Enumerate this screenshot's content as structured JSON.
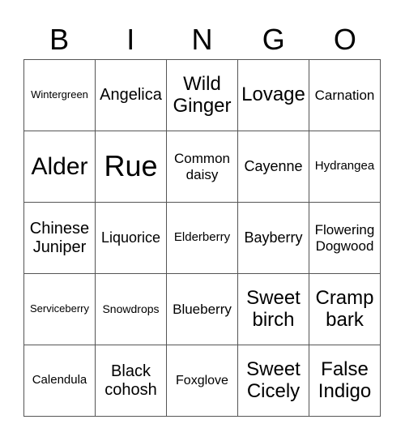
{
  "header": [
    "B",
    "I",
    "N",
    "G",
    "O"
  ],
  "cells": [
    [
      "Wintergreen",
      "Angelica",
      "Wild Ginger",
      "Lovage",
      "Carnation"
    ],
    [
      "Alder",
      "Rue",
      "Common daisy",
      "Cayenne",
      "Hydrangea"
    ],
    [
      "Chinese Juniper",
      "Liquorice",
      "Elderberry",
      "Bayberry",
      "Flowering Dogwood"
    ],
    [
      "Serviceberry",
      "Snowdrops",
      "Blueberry",
      "Sweet birch",
      "Cramp bark"
    ],
    [
      "Calendula",
      "Black cohosh",
      "Foxglove",
      "Sweet Cicely",
      "False Indigo"
    ]
  ]
}
